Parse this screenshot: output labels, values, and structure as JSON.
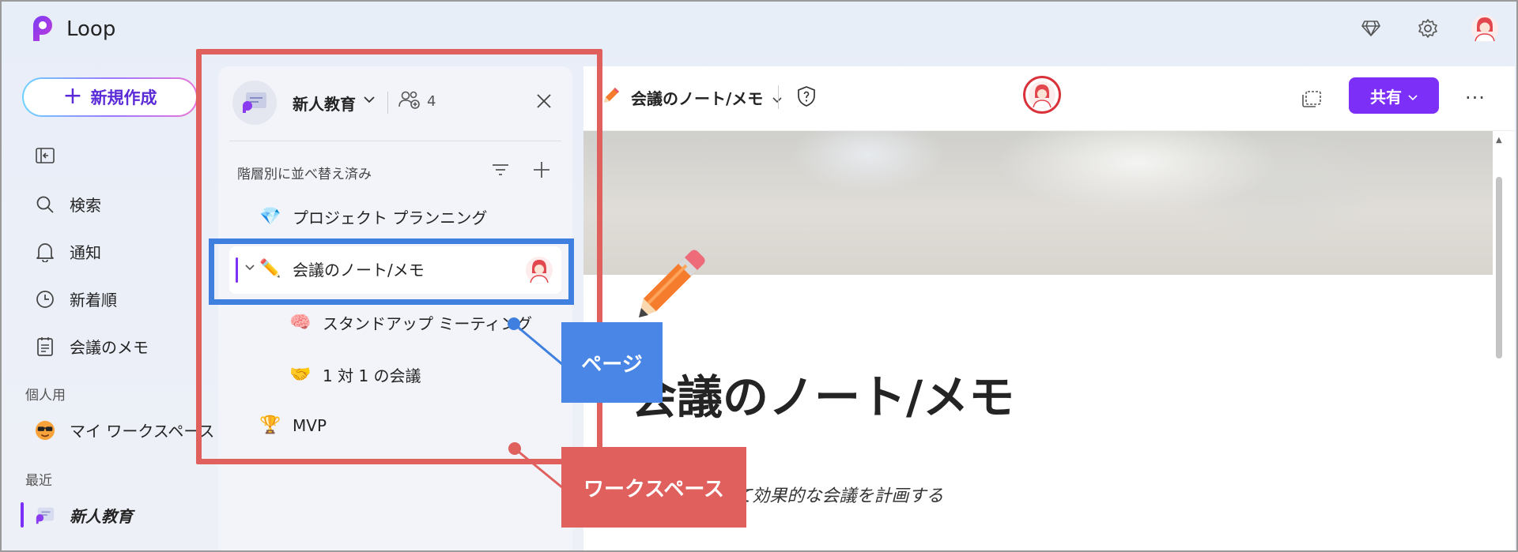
{
  "app": {
    "name": "Loop"
  },
  "top_icons": [
    "premium-diamond-icon",
    "settings-gear-icon",
    "user-avatar"
  ],
  "left_nav": {
    "new_button": "新規作成",
    "collapse_icon": "sidebar-collapse-icon",
    "items": [
      {
        "label": "検索",
        "icon": "search-icon"
      },
      {
        "label": "通知",
        "icon": "bell-icon"
      },
      {
        "label": "新着順",
        "icon": "clock-icon"
      },
      {
        "label": "会議のメモ",
        "icon": "notes-icon"
      }
    ],
    "personal_label": "個人用",
    "personal_items": [
      {
        "label": "マイ ワークスペース",
        "icon": "sunglasses-emoji-icon"
      }
    ],
    "recent_label": "最近",
    "recent_items": [
      {
        "label": "新人教育",
        "icon": "workspace-icon"
      }
    ]
  },
  "workspace": {
    "name": "新人教育",
    "member_count": "4",
    "sort_label": "階層別に並べ替え済み",
    "tree": [
      {
        "label": "プロジェクト プランニング",
        "emoji": "💎"
      },
      {
        "label": "会議のノート/メモ",
        "emoji": "✏️"
      },
      {
        "label": "スタンドアップ ミーティング",
        "emoji": "🧠"
      },
      {
        "label": "1 対 1 の会議",
        "emoji": "🤝"
      },
      {
        "label": "MVP",
        "emoji": "🏆"
      }
    ]
  },
  "page": {
    "title": "会議のノート/メモ",
    "heading": "会議のノート/メモ",
    "subtitle": "ートを使用して効果的な会議を計画する",
    "share_label": "共有",
    "more_label": "···"
  },
  "annotations": {
    "page_label": "ページ",
    "workspace_label": "ワークスペース"
  },
  "colors": {
    "accent": "#7b2ff7",
    "annotation_red": "#e0605e",
    "annotation_blue": "#3e7fe0"
  }
}
